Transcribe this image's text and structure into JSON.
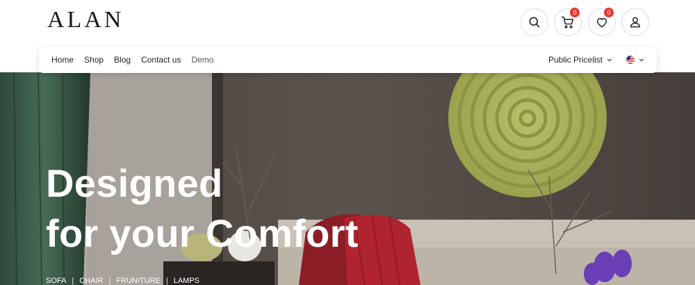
{
  "brand": {
    "logo_text": "ALAN"
  },
  "header_icons": {
    "search": {
      "icon": "search-icon"
    },
    "cart": {
      "icon": "cart-icon",
      "count": "0"
    },
    "wishlist": {
      "icon": "heart-icon",
      "count": "0"
    },
    "account": {
      "icon": "user-icon"
    },
    "badge_color": "#e53935"
  },
  "nav": {
    "items": [
      {
        "label": "Home"
      },
      {
        "label": "Shop"
      },
      {
        "label": "Blog"
      },
      {
        "label": "Contact us"
      },
      {
        "label": "Demo"
      }
    ],
    "pricelist_label": "Public Pricelist",
    "language_flag": "us-flag-icon"
  },
  "hero": {
    "headline_line1": "Designed",
    "headline_line2": "for your Comfort",
    "categories": [
      "SOFA",
      "CHAIR",
      "FRUNITURE",
      "LAMPS"
    ],
    "separator": "|"
  }
}
